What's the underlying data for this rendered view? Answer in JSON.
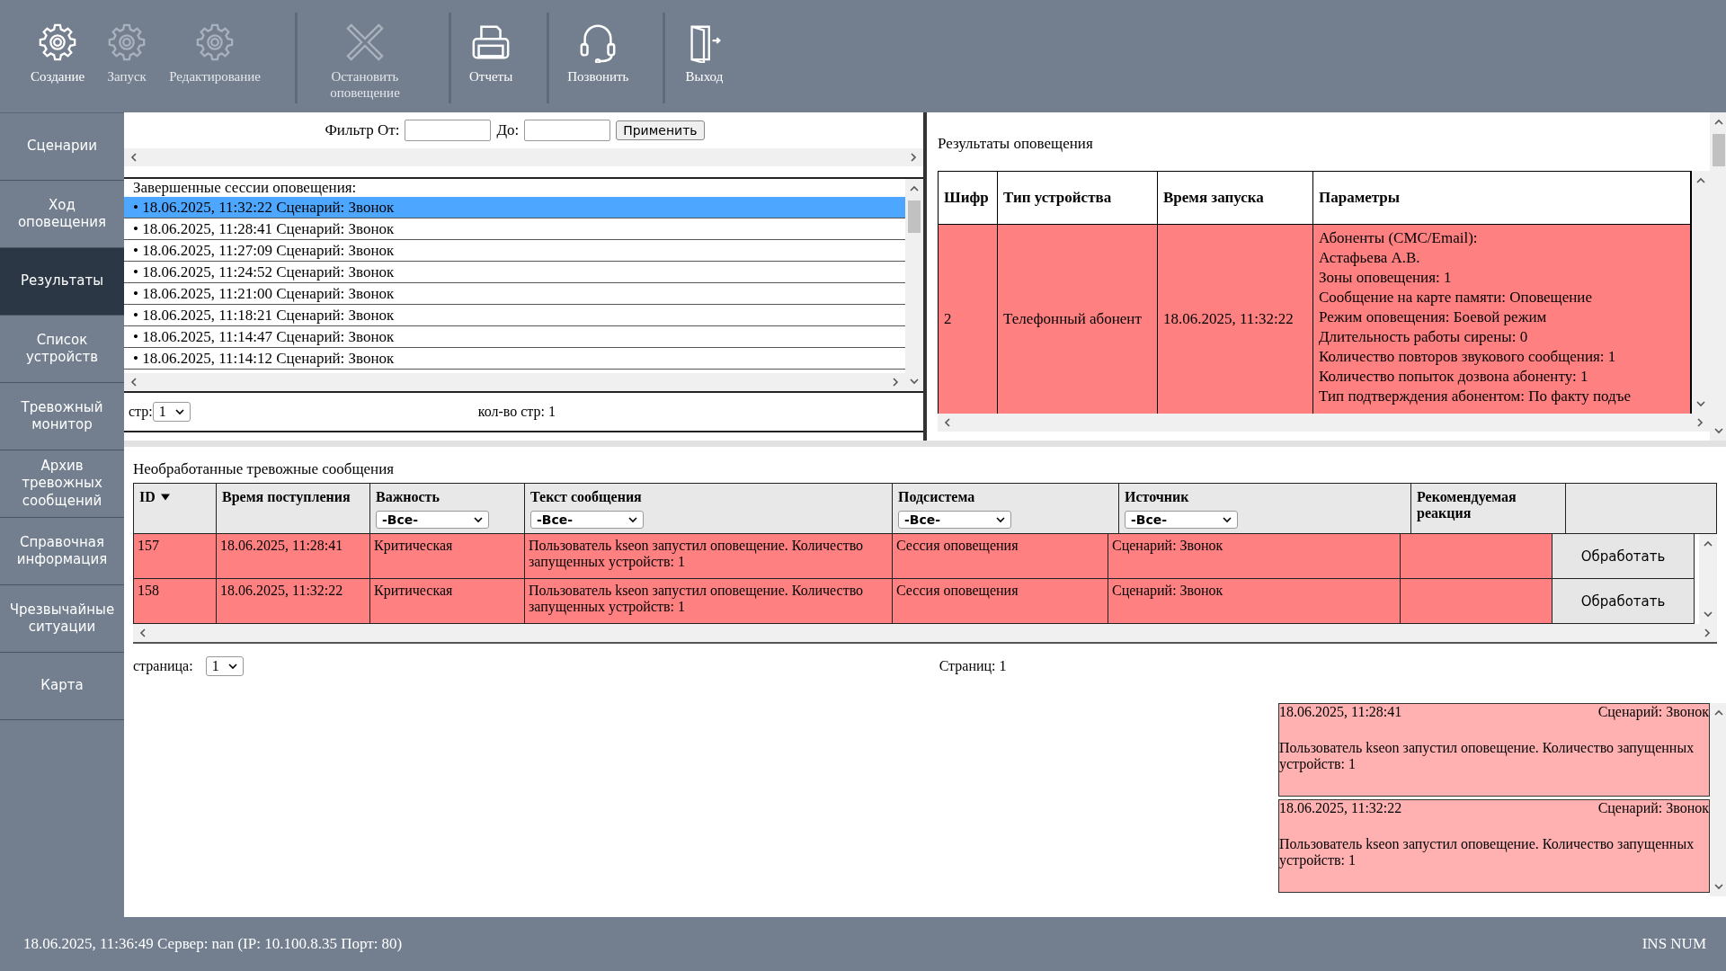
{
  "toolbar": {
    "groups": [
      [
        {
          "label": "Создание",
          "kind": "gear",
          "disabled": false
        },
        {
          "label": "Запуск",
          "kind": "gear",
          "disabled": true
        },
        {
          "label": "Редактирование",
          "kind": "gear",
          "disabled": true
        }
      ],
      [
        {
          "label": "Остановить оповещение",
          "kind": "cross",
          "disabled": true
        }
      ],
      [
        {
          "label": "Отчеты",
          "kind": "printer",
          "disabled": false
        }
      ],
      [
        {
          "label": "Позвонить",
          "kind": "headset",
          "disabled": false
        }
      ],
      [
        {
          "label": "Выход",
          "kind": "door",
          "disabled": false
        }
      ]
    ]
  },
  "sidebar": {
    "items": [
      {
        "label": "Сценарии",
        "selected": false
      },
      {
        "label": "Ход оповещения",
        "selected": false
      },
      {
        "label": "Результаты",
        "selected": true
      },
      {
        "label": "Список устройств",
        "selected": false
      },
      {
        "label": "Тревожный монитор",
        "selected": false
      },
      {
        "label": "Архив тревожных сообщений",
        "selected": false
      },
      {
        "label": "Справочная информация",
        "selected": false
      },
      {
        "label": "Чрезвычайные ситуации",
        "selected": false
      },
      {
        "label": "Карта",
        "selected": false
      }
    ]
  },
  "filter": {
    "from_label": "Фильтр От:",
    "to_label": "До:",
    "button": "Применить"
  },
  "sessions": {
    "title": "Завершенные сессии оповещения:",
    "items": [
      {
        "text": "• 18.06.2025, 11:32:22 Сценарий: Звонок",
        "selected": true
      },
      {
        "text": "• 18.06.2025, 11:28:41 Сценарий: Звонок",
        "selected": false
      },
      {
        "text": "• 18.06.2025, 11:27:09 Сценарий: Звонок",
        "selected": false
      },
      {
        "text": "• 18.06.2025, 11:24:52 Сценарий: Звонок",
        "selected": false
      },
      {
        "text": "• 18.06.2025, 11:21:00 Сценарий: Звонок",
        "selected": false
      },
      {
        "text": "• 18.06.2025, 11:18:21 Сценарий: Звонок",
        "selected": false
      },
      {
        "text": "• 18.06.2025, 11:14:47 Сценарий: Звонок",
        "selected": false
      },
      {
        "text": "• 18.06.2025, 11:14:12 Сценарий: Звонок",
        "selected": false
      }
    ],
    "pager": {
      "label": "стр:",
      "value": "1",
      "count": "кол-во стр: 1"
    }
  },
  "results": {
    "title": "Результаты оповещения",
    "columns": [
      "Шифр",
      "Тип устройства",
      "Время запуска",
      "Параметры"
    ],
    "rows": [
      {
        "cipher": "2",
        "device": "Телефонный абонент",
        "time": "18.06.2025, 11:32:22",
        "params": [
          "Абоненты (СМС/Email):",
          "Астафьева А.В.",
          "Зоны оповещения: 1",
          "Сообщение на карте памяти: Оповещение",
          "Режим оповещения: Боевой режим",
          "Длительность работы сирены: 0",
          "Количество повторов звукового сообщения: 1",
          "Количество попыток дозвона абоненту: 1",
          "Тип подтверждения абонентом: По факту подъе"
        ]
      }
    ]
  },
  "alarms": {
    "title": "Необработанные тревожные сообщения",
    "columns": [
      {
        "label": "ID",
        "sort": true
      },
      {
        "label": "Время поступления"
      },
      {
        "label": "Важность",
        "filter": "-Все-"
      },
      {
        "label": "Текст сообщения",
        "filter": "-Все-"
      },
      {
        "label": "Подсистема",
        "filter": "-Все-"
      },
      {
        "label": "Источник",
        "filter": "-Все-"
      },
      {
        "label": "Рекомендуемая реакция"
      }
    ],
    "rows": [
      {
        "id": "157",
        "time": "18.06.2025, 11:28:41",
        "severity": "Критическая",
        "text": "Пользователь kseon запустил оповещение. Количество запущенных устройств: 1",
        "subsystem": "Сессия оповещения",
        "source": "Сценарий: Звонок",
        "button": "Обработать"
      },
      {
        "id": "158",
        "time": "18.06.2025, 11:32:22",
        "severity": "Критическая",
        "text": "Пользователь kseon запустил оповещение. Количество запущенных устройств: 1",
        "subsystem": "Сессия оповещения",
        "source": "Сценарий: Звонок",
        "button": "Обработать"
      }
    ],
    "pager": {
      "label": "страница:",
      "value": "1",
      "total": "Страниц: 1"
    }
  },
  "notifications": [
    {
      "time": "18.06.2025, 11:28:41",
      "scenario": "Сценарий: Звонок",
      "text": "Пользователь kseon запустил оповещение. Количество запущенных устройств: 1"
    },
    {
      "time": "18.06.2025, 11:32:22",
      "scenario": "Сценарий: Звонок",
      "text": "Пользователь kseon запустил оповещение. Количество запущенных устройств: 1"
    }
  ],
  "status_bar": {
    "left": "18.06.2025, 11:36:49 Сервер: nan (IP: 10.100.8.35 Порт: 80)",
    "right": "INS NUM"
  }
}
